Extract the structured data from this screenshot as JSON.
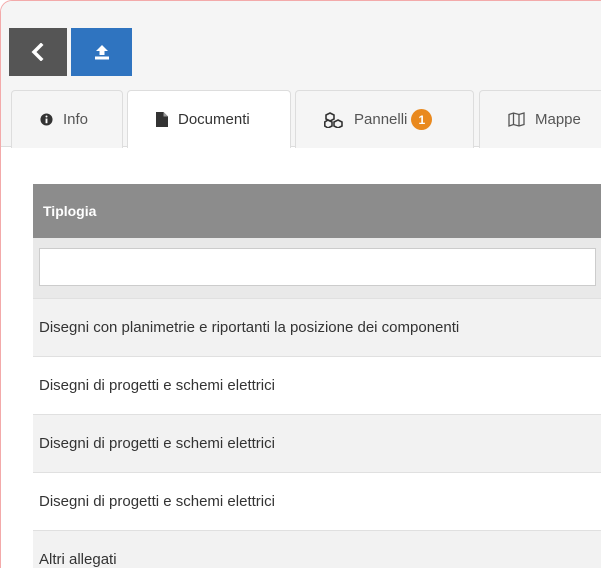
{
  "toolbar": {
    "back_icon": "chevron-left-icon",
    "upload_icon": "upload-icon",
    "back_color": "#555555",
    "upload_color": "#2f74c0"
  },
  "tabs": [
    {
      "label": "Info",
      "icon": "info-circle-icon",
      "active": false
    },
    {
      "label": "Documenti",
      "icon": "file-icon",
      "active": true
    },
    {
      "label": "Pannelli",
      "icon": "cubes-icon",
      "active": false,
      "badge": "1"
    },
    {
      "label": "Mappe",
      "icon": "map-icon",
      "active": false
    }
  ],
  "table": {
    "header": "Tiplogia",
    "filter": {
      "value": "",
      "placeholder": ""
    },
    "rows": [
      "Disegni con planimetrie e riportanti la posizione dei componenti",
      "Disegni di progetti e schemi elettrici",
      "Disegni di progetti e schemi elettrici",
      "Disegni di progetti e schemi elettrici",
      "Altri allegati"
    ]
  },
  "colors": {
    "badge": "#e9891e",
    "header_bg": "#8c8c8c"
  }
}
